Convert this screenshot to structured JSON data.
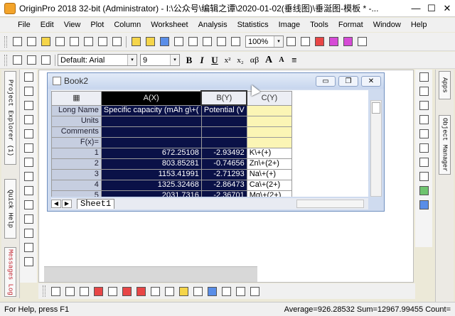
{
  "window": {
    "title": "OriginPro 2018 32-bit (Administrator) - I:\\公众号\\编辑之谭\\2020-01-02(垂线图)\\垂涎图-模板 * -...",
    "minimize": "—",
    "maximize": "☐",
    "close": "✕"
  },
  "menu": [
    "File",
    "Edit",
    "View",
    "Plot",
    "Column",
    "Worksheet",
    "Analysis",
    "Statistics",
    "Image",
    "Tools",
    "Format",
    "Window",
    "Help"
  ],
  "toolbar": {
    "zoom": "100%",
    "zoom_caret": "▾"
  },
  "format_toolbar": {
    "font": "Default: Arial",
    "size": "9",
    "bold": "B",
    "italic": "I",
    "underline": "U",
    "superscript": "x²",
    "subscript": "x₂",
    "greek": "αβ",
    "grow": "A",
    "shrink": "A",
    "align": "≡"
  },
  "left_dock": {
    "project_explorer": "Project Explorer (1)",
    "quick_help": "Quick Help",
    "messages_log": "Messages Log"
  },
  "right_dock": {
    "apps": "Apps",
    "object_manager": "Object Manager"
  },
  "book": {
    "name": "Book2",
    "minimize": "▭",
    "restore": "❐",
    "close": "✕"
  },
  "worksheet": {
    "corner": "▦",
    "columns": [
      "A(X)",
      "B(Y)",
      "C(Y)"
    ],
    "header_rows": [
      {
        "label": "Long Name",
        "cells": [
          "Specific capacity (mAh g\\+(",
          "Potential (V",
          ""
        ]
      },
      {
        "label": "Units",
        "cells": [
          "",
          "",
          ""
        ]
      },
      {
        "label": "Comments",
        "cells": [
          "",
          "",
          ""
        ]
      },
      {
        "label": "F(x)=",
        "cells": [
          "",
          "",
          ""
        ]
      }
    ],
    "rows": [
      {
        "n": "1",
        "a": "672.25108",
        "b": "-2.93492",
        "c": "K\\+(+)"
      },
      {
        "n": "2",
        "a": "803.85281",
        "b": "-0.74656",
        "c": "Zn\\+(2+)"
      },
      {
        "n": "3",
        "a": "1153.41991",
        "b": "-2.71293",
        "c": "Na\\+(+)"
      },
      {
        "n": "4",
        "a": "1325.32468",
        "b": "-2.86473",
        "c": "Ca\\+(2+)"
      },
      {
        "n": "5",
        "a": "2031.7316",
        "b": "-2.36701",
        "c": "Mg\\+(2+)"
      }
    ],
    "sheet_tab": "Sheet1",
    "nav_prev": "◀",
    "nav_next": "▶"
  },
  "status": {
    "left": "For Help, press F1",
    "right": "Average=926.28532 Sum=12967.99455 Count="
  }
}
